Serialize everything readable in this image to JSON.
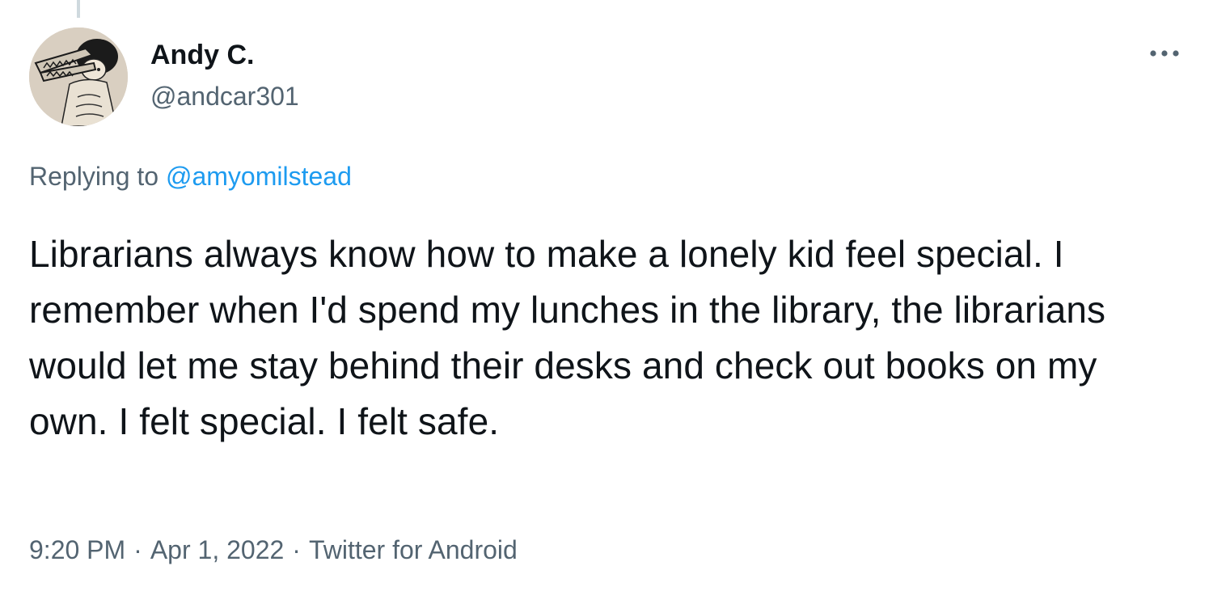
{
  "tweet": {
    "author": {
      "display_name": "Andy C.",
      "handle": "@andcar301"
    },
    "more_icon": "more-horizontal-icon",
    "reply": {
      "prefix": "Replying to",
      "mention": "@amyomilstead"
    },
    "text": "Librarians always know how to make a lonely kid feel special. I remember when I'd spend my lunches in the library, the librarians would let me stay behind their desks and check out books on my own. I felt special. I felt safe.",
    "meta": {
      "time": "9:20 PM",
      "separator": "·",
      "date": "Apr 1, 2022",
      "source": "Twitter for Android"
    }
  },
  "colors": {
    "text_primary": "#0f1419",
    "text_secondary": "#536471",
    "link": "#1d9bf0",
    "thread_line": "#cfd9de"
  }
}
